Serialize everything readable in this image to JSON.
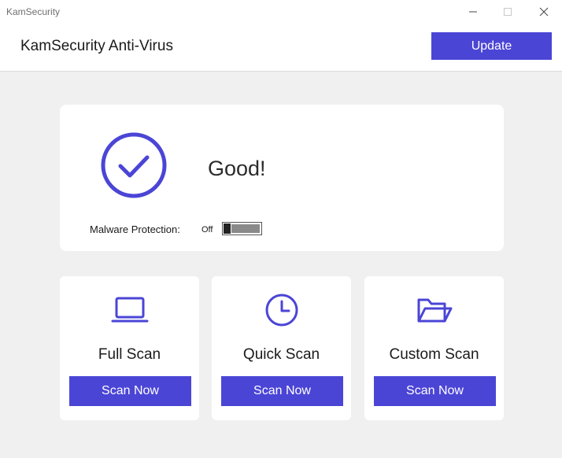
{
  "window": {
    "title": "KamSecurity",
    "controls": [
      "minimize-icon",
      "maximize-icon",
      "close-icon"
    ]
  },
  "header": {
    "app_name": "KamSecurity Anti-Virus",
    "update_label": "Update"
  },
  "status": {
    "text": "Good!",
    "icon": "check-circle-icon",
    "malware_protection_label": "Malware Protection:",
    "malware_protection_state": "Off",
    "malware_protection_enabled": false
  },
  "scans": [
    {
      "title": "Full Scan",
      "icon": "laptop-icon",
      "button_label": "Scan Now"
    },
    {
      "title": "Quick Scan",
      "icon": "clock-icon",
      "button_label": "Scan Now"
    },
    {
      "title": "Custom Scan",
      "icon": "folder-open-icon",
      "button_label": "Scan Now"
    }
  ],
  "colors": {
    "accent": "#4b45d6",
    "background": "#f0f0f0",
    "card": "#ffffff"
  }
}
